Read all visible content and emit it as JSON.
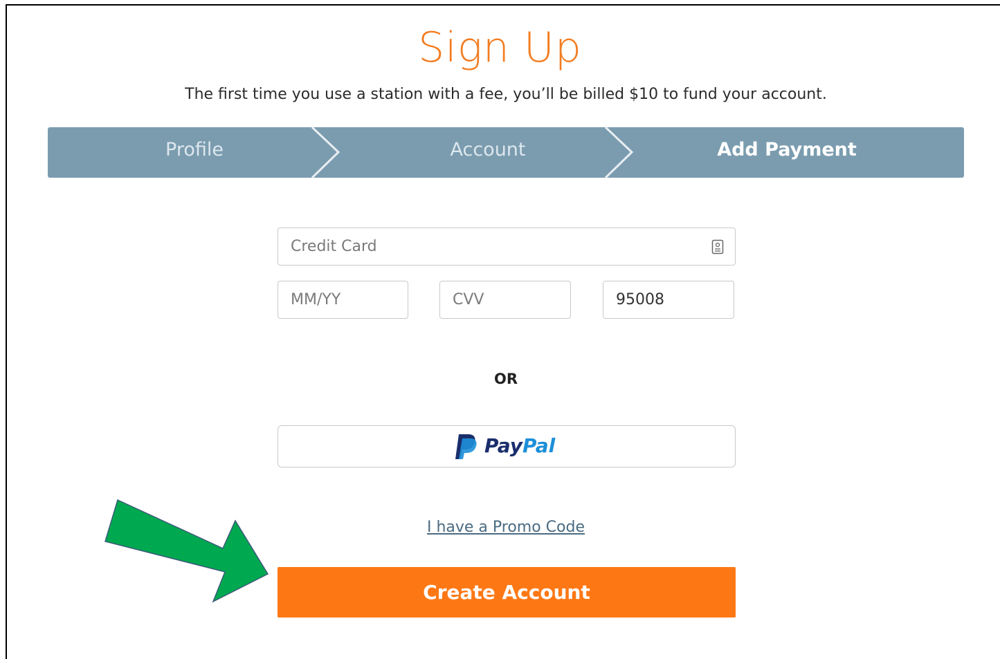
{
  "header": {
    "title": "Sign Up",
    "subtitle": "The first time you use a station with a fee, you’ll be billed $10 to fund your account."
  },
  "steps": [
    {
      "label": "Profile",
      "active": false
    },
    {
      "label": "Account",
      "active": false
    },
    {
      "label": "Add Payment",
      "active": true
    }
  ],
  "payment_form": {
    "credit_card": {
      "placeholder": "Credit Card",
      "value": "",
      "icon": "card-autofill-icon"
    },
    "expiry": {
      "placeholder": "MM/YY",
      "value": ""
    },
    "cvv": {
      "placeholder": "CVV",
      "value": ""
    },
    "zip": {
      "placeholder": "",
      "value": "95008"
    }
  },
  "divider_text": "OR",
  "paypal": {
    "brand_pay": "Pay",
    "brand_pal": "Pal",
    "icon": "paypal-logo-icon"
  },
  "promo_link": "I have a Promo Code",
  "create_button": "Create Account",
  "annotation": {
    "icon": "green-arrow-icon",
    "color": "#00a94f"
  },
  "colors": {
    "title_orange": "#f37c20",
    "step_bar": "#7b9caf",
    "button_orange": "#fd7815",
    "link": "#4a6a82"
  }
}
